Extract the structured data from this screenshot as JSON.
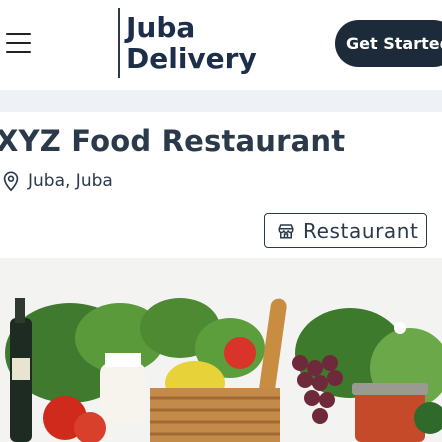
{
  "header": {
    "brand_line1": "Juba",
    "brand_line2": "Delivery",
    "cta_label": "Get Started",
    "menu_icon": "hamburger-menu-icon"
  },
  "restaurant": {
    "name": "XYZ Food Restaurant",
    "location": "Juba, Juba",
    "location_icon": "map-pin-icon",
    "category": "Restaurant",
    "category_icon": "storefront-icon"
  },
  "colors": {
    "brand_navy": "#1c2e4a",
    "cta_bg": "#1c2a3a",
    "band_bg": "#eef1f5"
  }
}
